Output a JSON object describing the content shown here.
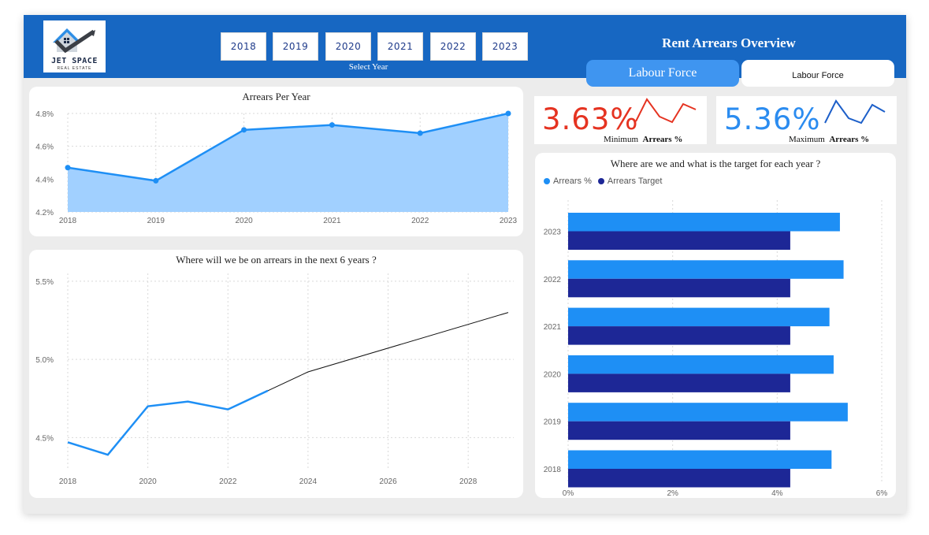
{
  "header": {
    "logo": {
      "name": "JET SPACE",
      "tagline": "REAL ESTATE"
    },
    "year_filter": {
      "years": [
        "2018",
        "2019",
        "2020",
        "2021",
        "2022",
        "2023"
      ],
      "label": "Select Year"
    },
    "report_title": "Rent Arrears Overview",
    "tabs": [
      {
        "label": "Labour Force",
        "active": true
      },
      {
        "label": "Labour Force",
        "active": false
      }
    ]
  },
  "kpis": {
    "min": {
      "value": "3.63%",
      "caption_prefix": "Minimum",
      "caption_bold": "Arrears %",
      "color": "#e53321"
    },
    "max": {
      "value": "5.36%",
      "caption_prefix": "Maximum",
      "caption_bold": "Arrears %",
      "color": "#2b8cf0"
    }
  },
  "colors": {
    "primary": "#1e8ff5",
    "area_fill": "#a1d0ff",
    "target": "#1d2796",
    "banner": "#1767c2",
    "forecast": "#111111"
  },
  "charts": {
    "arrears_per_year": {
      "title": "Arrears Per Year"
    },
    "forecast": {
      "title": "Where will we be on arrears in the next 6 years ?"
    },
    "target": {
      "title": "Where are we and what is the target for each year ?"
    }
  },
  "chart_data": [
    {
      "type": "area",
      "title": "Arrears Per Year",
      "x": [
        "2018",
        "2019",
        "2020",
        "2021",
        "2022",
        "2023"
      ],
      "values": [
        4.47,
        4.39,
        4.7,
        4.73,
        4.68,
        4.8
      ],
      "ylim": [
        4.2,
        4.8
      ],
      "yticks": [
        "4.2%",
        "4.4%",
        "4.6%",
        "4.8%"
      ],
      "grid": true
    },
    {
      "type": "line",
      "title": "Where will we be on arrears in the next 6 years ?",
      "actual": {
        "x": [
          2018,
          2019,
          2020,
          2021,
          2022,
          2023
        ],
        "values": [
          4.47,
          4.39,
          4.7,
          4.73,
          4.68,
          4.8
        ]
      },
      "forecast": {
        "x": [
          2023,
          2024,
          2029
        ],
        "values": [
          4.8,
          4.92,
          5.3
        ]
      },
      "xticks": [
        "2018",
        "2020",
        "2022",
        "2024",
        "2026",
        "2028"
      ],
      "yticks": [
        "4.5%",
        "5.0%",
        "5.5%"
      ],
      "ylim": [
        4.3,
        5.55
      ],
      "grid": true
    },
    {
      "type": "bar",
      "orientation": "horizontal",
      "title": "Where are we and what is the target for each year ?",
      "categories": [
        "2023",
        "2022",
        "2021",
        "2020",
        "2019",
        "2018"
      ],
      "series": [
        {
          "name": "Arrears %",
          "values": [
            5.2,
            5.27,
            5.0,
            5.08,
            5.35,
            5.04
          ]
        },
        {
          "name": "Arrears Target",
          "values": [
            4.25,
            4.25,
            4.25,
            4.25,
            4.25,
            4.25
          ]
        }
      ],
      "xticks": [
        "0%",
        "2%",
        "4%",
        "6%"
      ],
      "xlim": [
        0,
        6
      ],
      "legend": "top-left",
      "grid": true
    }
  ]
}
